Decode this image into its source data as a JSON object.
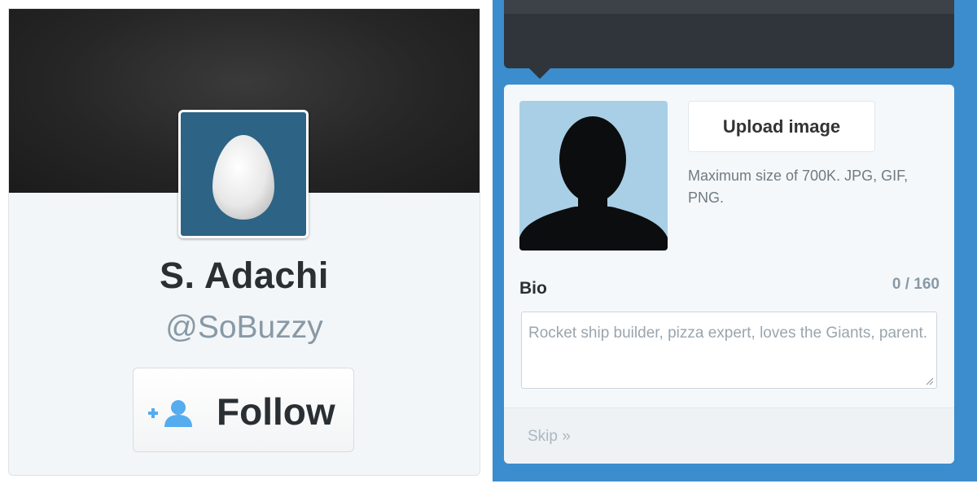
{
  "profile": {
    "display_name": "S. Adachi",
    "handle": "@SoBuzzy",
    "follow_label": "Follow",
    "avatar_icon": "egg-icon",
    "follow_icon": "add-user-icon"
  },
  "editor": {
    "upload_label": "Upload image",
    "upload_hint": "Maximum size of 700K. JPG, GIF, PNG.",
    "photo_icon": "default-person-silhouette-icon",
    "bio_label": "Bio",
    "bio_counter": "0 / 160",
    "bio_placeholder": "Rocket ship builder, pizza expert, loves the Giants, parent.",
    "skip_label": "Skip »"
  },
  "colors": {
    "avatar_bg": "#2d6385",
    "follow_icon": "#55acee",
    "panel_blue": "#3b8dce",
    "photo_bg": "#a9cfe6"
  }
}
